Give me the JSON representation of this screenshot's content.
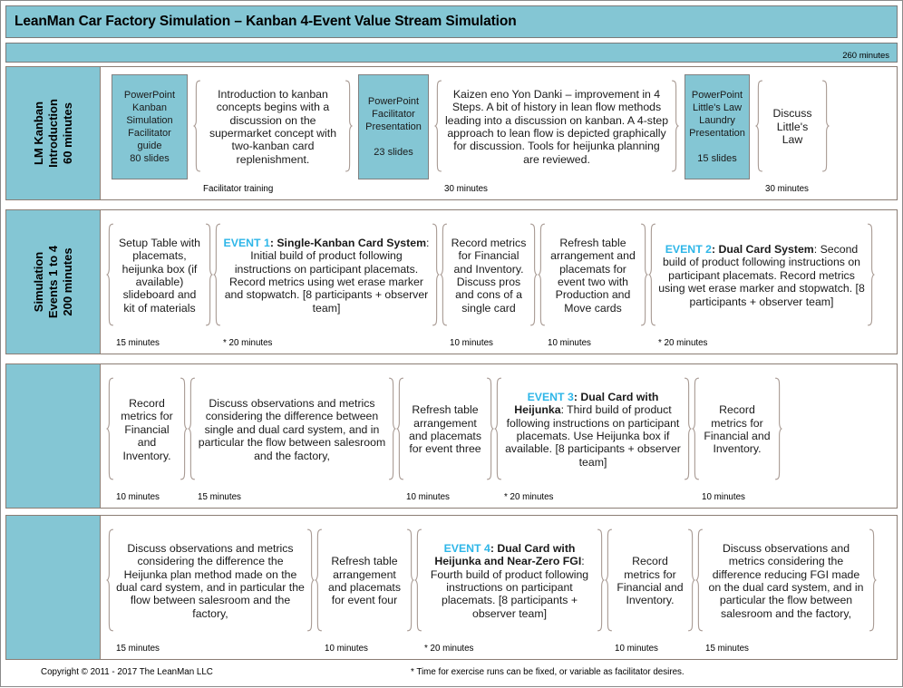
{
  "header": {
    "title": "LeanMan Car Factory Simulation – Kanban 4-Event Value Stream Simulation",
    "total_duration": "260 minutes"
  },
  "sections": [
    {
      "label": "LM Kanban\nIntroduction\n60 minutes",
      "items": [
        {
          "type": "ppt",
          "name": "powerpoint-kanban-simulation-facilitator-guide",
          "text": "PowerPoint\nKanban\nSimulation\nFacilitator\nguide\n80 slides",
          "duration": ""
        },
        {
          "type": "text",
          "name": "intro-kanban-concepts",
          "text": "Introduction to kanban concepts begins with a discussion on the supermarket concept with two-kanban card replenishment.",
          "duration": "Facilitator training"
        },
        {
          "type": "ppt",
          "name": "powerpoint-facilitator-presentation",
          "text": "PowerPoint\nFacilitator\nPresentation\n\n23 slides",
          "duration": ""
        },
        {
          "type": "text",
          "name": "kaizen-eno-yon-danki",
          "text": "Kaizen eno Yon Danki – improvement in 4 Steps. A bit of history in lean flow methods leading into a discussion on kanban. A 4-step approach to lean flow is depicted graphically for discussion.  Tools for heijunka planning are reviewed.",
          "duration": "30 minutes"
        },
        {
          "type": "ppt",
          "name": "powerpoint-littles-law-laundry-presentation",
          "text": "PowerPoint\nLittle's Law\nLaundry\nPresentation\n\n15 slides",
          "duration": ""
        },
        {
          "type": "text",
          "name": "discuss-littles-law",
          "text": "Discuss Little's Law",
          "duration": "30 minutes"
        }
      ]
    },
    {
      "label": "Simulation\nEvents 1 to 4\n200 minutes",
      "items": [
        {
          "type": "text",
          "name": "setup-table",
          "text": "Setup Table with placemats, heijunka box (if available) slideboard and kit of materials",
          "duration": "15 minutes"
        },
        {
          "type": "event",
          "name": "event-1-single-kanban-card-system",
          "event_label": "EVENT 1",
          "event_title": ":  Single-Kanban Card System",
          "text": ": Initial build of product following instructions on participant placemats.  Record metrics using wet erase marker and stopwatch. [8 participants + observer team]",
          "duration": "* 20 minutes"
        },
        {
          "type": "text",
          "name": "record-metrics-discuss-single-card",
          "text": "Record metrics for Financial and Inventory. Discuss pros and cons of a single card",
          "duration": "10 minutes"
        },
        {
          "type": "text",
          "name": "refresh-table-event-two",
          "text": "Refresh table arrangement and placemats for event two with Production and Move cards",
          "duration": "10 minutes"
        },
        {
          "type": "event",
          "name": "event-2-dual-card-system",
          "event_label": "EVENT 2",
          "event_title": ": Dual Card System",
          "text": ": Second build of product following instructions on participant placemats.  Record metrics using wet erase marker and stopwatch. [8 participants + observer team]",
          "duration": "* 20 minutes"
        }
      ]
    },
    {
      "label": "",
      "items": [
        {
          "type": "text",
          "name": "record-metrics-financial-inventory-1",
          "text": "Record metrics for Financial and Inventory.",
          "duration": "10 minutes"
        },
        {
          "type": "text",
          "name": "discuss-single-vs-dual-card",
          "text": "Discuss observations and metrics considering the difference between single and dual card system, and in particular the flow between salesroom and the factory,",
          "duration": "15 minutes"
        },
        {
          "type": "text",
          "name": "refresh-table-event-three",
          "text": "Refresh table arrangement and placemats for event three",
          "duration": "10 minutes"
        },
        {
          "type": "event",
          "name": "event-3-dual-card-with-heijunka",
          "event_label": "EVENT 3",
          "event_title": ": Dual Card with Heijunka",
          "text": ": Third build of product following instructions on participant placemats. Use Heijunka box if available. [8 participants + observer team]",
          "duration": "* 20 minutes"
        },
        {
          "type": "text",
          "name": "record-metrics-financial-inventory-2",
          "text": "Record metrics for Financial and Inventory.",
          "duration": "10 minutes"
        }
      ]
    },
    {
      "label": "",
      "items": [
        {
          "type": "text",
          "name": "discuss-heijunka-plan-method",
          "text": "Discuss observations and metrics considering the difference the Heijunka plan method made on the dual card system, and in particular the flow between salesroom and the factory,",
          "duration": "15 minutes"
        },
        {
          "type": "text",
          "name": "refresh-table-event-four",
          "text": "Refresh table arrangement and placemats for event four",
          "duration": "10 minutes"
        },
        {
          "type": "event",
          "name": "event-4-dual-card-heijunka-near-zero-fgi",
          "event_label": "EVENT 4",
          "event_title": ": Dual Card with Heijunka and Near-Zero FGI",
          "text": ": Fourth build of product following instructions on participant placemats. [8 participants + observer team]",
          "duration": "* 20 minutes"
        },
        {
          "type": "text",
          "name": "record-metrics-financial-inventory-3",
          "text": "Record metrics for Financial and Inventory.",
          "duration": "10 minutes"
        },
        {
          "type": "text",
          "name": "discuss-reducing-fgi",
          "text": "Discuss observations and metrics considering the difference reducing FGI made on the dual card system, and in particular the flow between salesroom and the factory,",
          "duration": "15 minutes"
        }
      ]
    }
  ],
  "footer": {
    "copyright": "Copyright © 2011 - 2017 The LeanMan LLC",
    "footnote": "* Time for exercise runs can be fixed, or variable as facilitator desires."
  },
  "colors": {
    "accent": "#84c6d4",
    "event_label": "#2eb6e8",
    "section_border": "#8b7d74",
    "brace": "#a89a93"
  }
}
